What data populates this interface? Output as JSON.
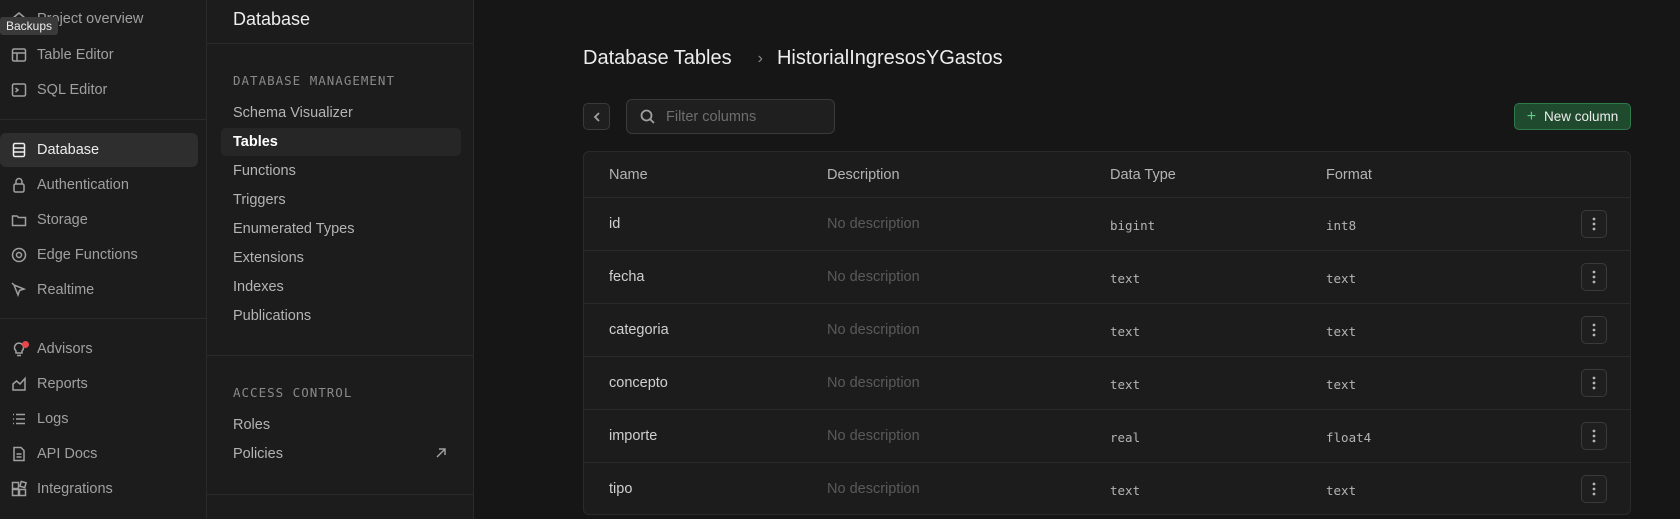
{
  "nav": {
    "tooltip": "Backups",
    "items": [
      {
        "label": "Project overview",
        "icon": "home-icon"
      },
      {
        "label": "Table Editor",
        "icon": "table-icon"
      },
      {
        "label": "SQL Editor",
        "icon": "terminal-icon"
      },
      {
        "label": "Database",
        "icon": "database-icon",
        "active": true
      },
      {
        "label": "Authentication",
        "icon": "lock-icon"
      },
      {
        "label": "Storage",
        "icon": "folder-icon"
      },
      {
        "label": "Edge Functions",
        "icon": "globe-icon"
      },
      {
        "label": "Realtime",
        "icon": "cursor-icon"
      },
      {
        "label": "Advisors",
        "icon": "lightbulb-icon"
      },
      {
        "label": "Reports",
        "icon": "chart-icon"
      },
      {
        "label": "Logs",
        "icon": "list-icon"
      },
      {
        "label": "API Docs",
        "icon": "document-icon"
      },
      {
        "label": "Integrations",
        "icon": "grid-icon"
      }
    ]
  },
  "menu": {
    "title": "Database",
    "sections": [
      {
        "heading": "DATABASE MANAGEMENT",
        "items": [
          "Schema Visualizer",
          "Tables",
          "Functions",
          "Triggers",
          "Enumerated Types",
          "Extensions",
          "Indexes",
          "Publications"
        ]
      },
      {
        "heading": "ACCESS CONTROL",
        "items": [
          "Roles",
          "Policies"
        ]
      }
    ]
  },
  "main": {
    "breadcrumb": [
      "Database Tables",
      "HistorialIngresosYGastos"
    ],
    "search": {
      "placeholder": "Filter columns",
      "value": ""
    },
    "new_column_label": "New column",
    "table": {
      "headers": [
        "Name",
        "Description",
        "Data Type",
        "Format"
      ],
      "rows": [
        {
          "name": "id",
          "description": "No description",
          "type": "bigint",
          "format": "int8"
        },
        {
          "name": "fecha",
          "description": "No description",
          "type": "text",
          "format": "text"
        },
        {
          "name": "categoria",
          "description": "No description",
          "type": "text",
          "format": "text"
        },
        {
          "name": "concepto",
          "description": "No description",
          "type": "text",
          "format": "text"
        },
        {
          "name": "importe",
          "description": "No description",
          "type": "real",
          "format": "float4"
        },
        {
          "name": "tipo",
          "description": "No description",
          "type": "text",
          "format": "text"
        }
      ]
    }
  },
  "colors": {
    "accent": "#3ecf8e",
    "background": "#161616",
    "panel": "#1c1c1c",
    "alert_dot": "#e5484d"
  }
}
